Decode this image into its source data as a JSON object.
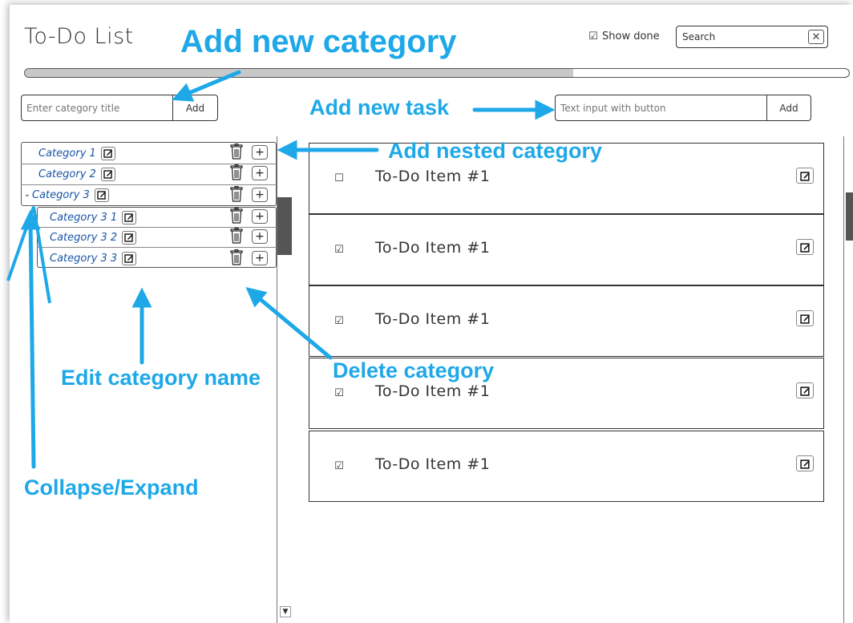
{
  "app": {
    "title": "To-Do List"
  },
  "header": {
    "show_done_label": "Show done",
    "show_done_checked": true,
    "search_value": "Search",
    "progress_fraction": 0.665
  },
  "category_input": {
    "placeholder": "Enter category title",
    "button_label": "Add"
  },
  "task_input": {
    "placeholder": "Text input with button",
    "button_label": "Add"
  },
  "categories": [
    {
      "label": "Category 1"
    },
    {
      "label": "Category 2"
    },
    {
      "label": "Category 3",
      "expanded": true
    },
    {
      "label": "Category 3 1"
    },
    {
      "label": "Category 3 2"
    },
    {
      "label": "Category 3 3"
    }
  ],
  "todos": [
    {
      "text": "To-Do Item #1",
      "done": false
    },
    {
      "text": "To-Do Item #1",
      "done": true
    },
    {
      "text": "To-Do Item #1",
      "done": true
    },
    {
      "text": "To-Do Item #1",
      "done": true
    },
    {
      "text": "To-Do Item #1",
      "done": true
    }
  ],
  "annotations": {
    "add_new_category": "Add new category",
    "add_new_task": "Add new task",
    "add_nested_category": "Add nested category",
    "edit_category_name": "Edit category name",
    "delete_category": "Delete category",
    "collapse_expand": "Collapse/Expand"
  },
  "colors": {
    "annotation": "#1ea8e8",
    "category_link": "#1a56a8"
  },
  "icons": {
    "checkbox_checked": "☑",
    "checkbox_unchecked": "☐",
    "clear": "✕",
    "plus": "+",
    "chevron_down": "⌄"
  }
}
